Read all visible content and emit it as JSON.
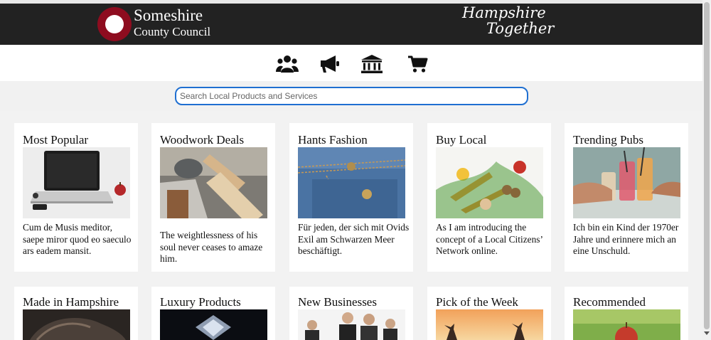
{
  "header": {
    "logo_line1": "Someshire",
    "logo_line2": "County Council",
    "brand_line1": "Hampshire",
    "brand_line2": "Together"
  },
  "nav_icons": [
    "community-icon",
    "megaphone-icon",
    "bank-icon",
    "shopping-cart-icon"
  ],
  "search": {
    "placeholder": "Search Local Products and Services"
  },
  "cards": [
    {
      "title": "Most Popular",
      "text": "Cum de Musis meditor, saepe miror quod eo saeculo ars eadem mansit.",
      "image": "laptop-apple"
    },
    {
      "title": "Woodwork Deals",
      "text": "The weightlessness of his soul never ceases to amaze him.",
      "image": "wood-lathe"
    },
    {
      "title": "Hants Fashion",
      "text": "Für jeden, der sich mit Ovids Exil am Schwarzen Meer beschäftigt.",
      "image": "denim-jeans"
    },
    {
      "title": "Buy Local",
      "text": "As I am introducing the concept of a Local Citizens’ Network online.",
      "image": "fresh-vegetables"
    },
    {
      "title": "Trending Pubs",
      "text": "Ich bin ein Kind der 1970er Jahre und erinnere mich an eine Unschuld.",
      "image": "cocktail-drinks"
    },
    {
      "title": "Made in Hampshire",
      "image": "leather-shoes"
    },
    {
      "title": "Luxury Products",
      "image": "diamond"
    },
    {
      "title": "New Businesses",
      "image": "business-people"
    },
    {
      "title": "Pick of the Week",
      "image": "sunset-people"
    },
    {
      "title": "Recommended",
      "image": "red-apple"
    }
  ]
}
